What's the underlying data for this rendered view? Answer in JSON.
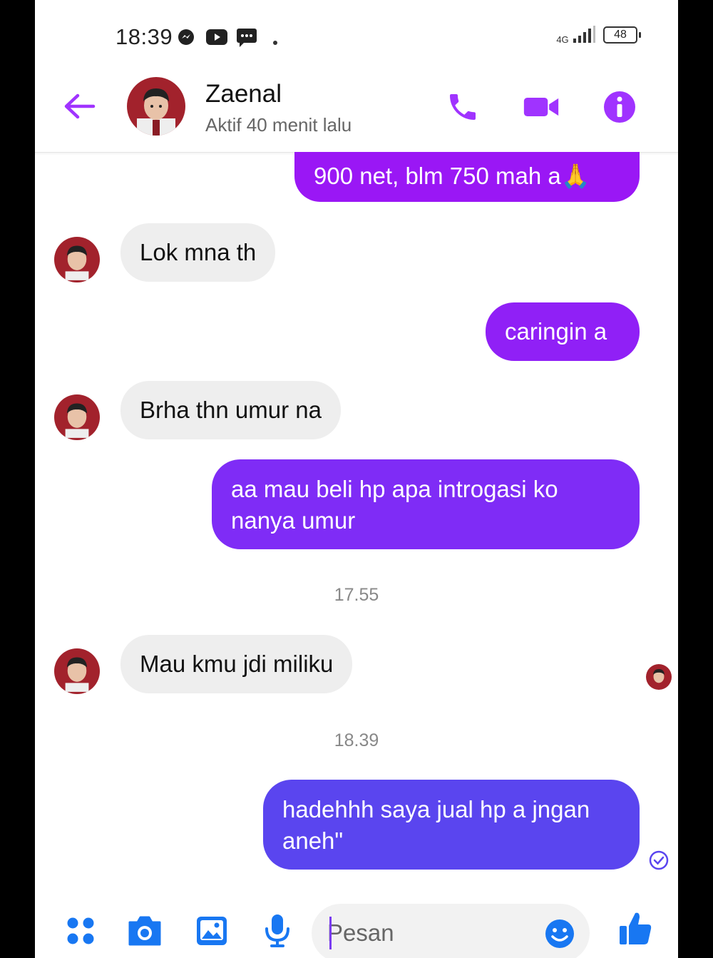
{
  "status_bar": {
    "time": "18:39",
    "network": "4G",
    "battery": "48",
    "icons": [
      "messenger-icon",
      "youtube-icon",
      "message-icon",
      "dot-icon",
      "signal-icon",
      "battery-icon"
    ]
  },
  "header": {
    "back_icon": "arrow-left-icon",
    "name": "Zaenal",
    "status": "Aktif 40 menit lalu",
    "actions": [
      "phone-icon",
      "video-call-icon",
      "info-icon"
    ]
  },
  "messages": [
    {
      "dir": "out",
      "text": "900 net, blm 750 mah a🙏"
    },
    {
      "dir": "in",
      "text": "Lok mna th"
    },
    {
      "dir": "out",
      "text": "caringin a"
    },
    {
      "dir": "in",
      "text": "Brha thn umur na"
    },
    {
      "dir": "out",
      "text": "aa mau beli hp apa introgasi ko nanya umur"
    },
    {
      "dir": "time",
      "text": "17.55"
    },
    {
      "dir": "in",
      "text": "Mau kmu jdi miliku"
    },
    {
      "dir": "time",
      "text": "18.39"
    },
    {
      "dir": "out",
      "text": "hadehhh saya jual hp a jngan aneh\""
    }
  ],
  "composer": {
    "placeholder": "Pesan",
    "icons": [
      "menu-dots-icon",
      "camera-icon",
      "image-icon",
      "microphone-icon",
      "emoji-icon",
      "thumbs-up-icon"
    ]
  },
  "colors": {
    "accent": "#a033ff",
    "bubble_top": "#9b17f5",
    "bubble_mid": "#7f2cf6",
    "bubble_bottom": "#5a45ef",
    "incoming_bubble": "#eeeeee"
  }
}
